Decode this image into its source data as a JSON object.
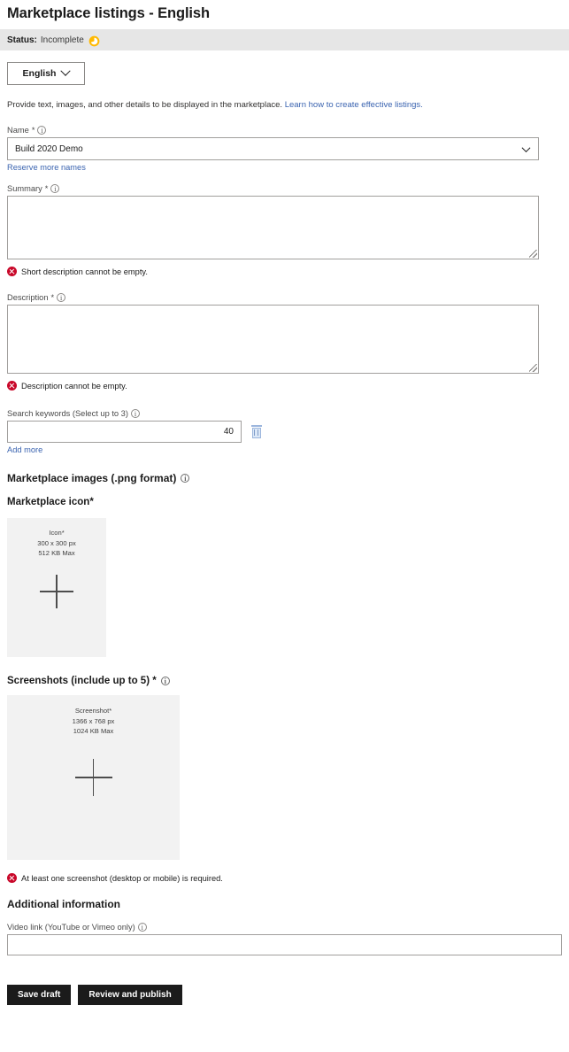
{
  "header": {
    "title": "Marketplace listings - English",
    "status_label": "Status:",
    "status_value": "Incomplete",
    "status_icon": "in-progress-clock-icon",
    "status_icon_color": "#ffb900",
    "status_bar_bg": "#e6e6e6"
  },
  "language": {
    "button_label": "English",
    "chevron": "chevron-down-icon"
  },
  "intro": {
    "text": "Provide text, images, and other details to be displayed in the marketplace.",
    "link_text": "Learn how to create effective listings.",
    "link_color": "#3b64b0"
  },
  "name_field": {
    "label": "Name",
    "required_mark": "*",
    "info_icon": "info-icon",
    "value": "Build 2020 Demo",
    "reserve_link": "Reserve more names"
  },
  "summary_field": {
    "label": "Summary",
    "required_mark": "*",
    "info_icon": "info-icon",
    "value": "",
    "error": "Short description cannot be empty."
  },
  "description_field": {
    "label": "Description",
    "required_mark": "*",
    "info_icon": "info-icon",
    "value": "",
    "error": "Description cannot be empty."
  },
  "search_keywords": {
    "label": "Search keywords (Select up to 3)",
    "info_icon": "info-icon",
    "value": "",
    "counter": "40",
    "delete_icon": "trash-icon",
    "add_more_link": "Add more"
  },
  "marketplace_images": {
    "heading": "Marketplace images (.png format)",
    "info_icon": "info-icon",
    "icon_subheading": "Marketplace icon*",
    "icon_upload": {
      "title": "Icon*",
      "dimensions": "300 x 300 px",
      "max_size": "512 KB Max",
      "add_icon": "plus-icon"
    },
    "screenshots_heading": "Screenshots (include up to 5) *",
    "screenshots_info_icon": "info-icon",
    "screenshot_upload": {
      "title": "Screenshot*",
      "dimensions": "1366 x 768 px",
      "max_size": "1024 KB Max",
      "add_icon": "plus-icon"
    },
    "screenshot_error": "At least one screenshot (desktop or mobile) is required."
  },
  "additional_information": {
    "heading": "Additional information",
    "video_label": "Video link (YouTube or Vimeo only)",
    "info_icon": "info-icon",
    "video_value": ""
  },
  "footer": {
    "save_draft_label": "Save draft",
    "review_publish_label": "Review and publish",
    "button_bg": "#1b1b1b"
  },
  "colors": {
    "error_red": "#c9082a",
    "link_blue": "#3b64b0",
    "upload_bg": "#f2f2f2",
    "border_gray": "#a19f9d"
  }
}
